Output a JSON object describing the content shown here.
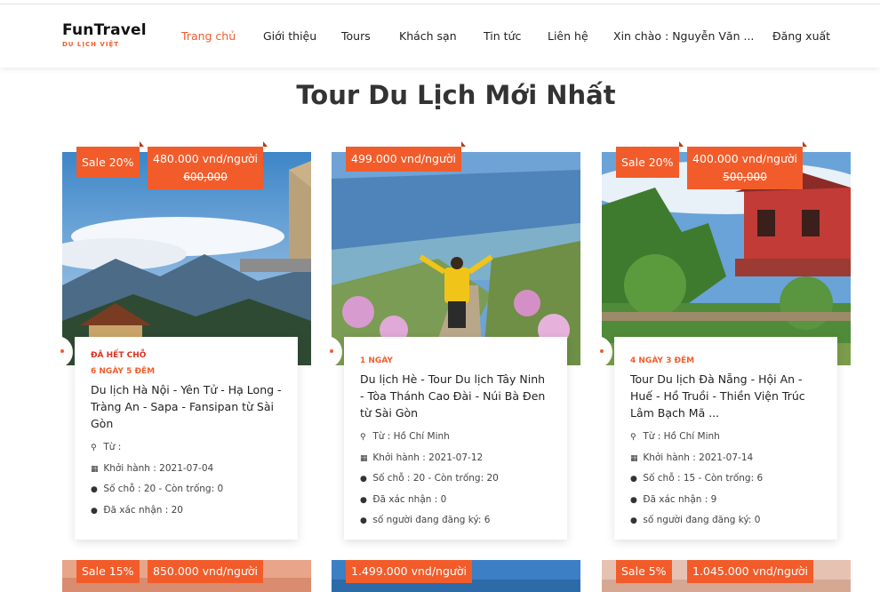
{
  "brand": {
    "name": "FunTravel",
    "tagline": "DU LỊCH VIỆT"
  },
  "nav": [
    {
      "label": "Trang chủ",
      "active": true
    },
    {
      "label": "Giới thiệu"
    },
    {
      "label": "Tours"
    },
    {
      "label": "Khách sạn"
    },
    {
      "label": "Tin tức"
    },
    {
      "label": "Liên hệ"
    },
    {
      "label": "Xin chào : Nguyễn Văn ..."
    },
    {
      "label": "Đăng xuất"
    }
  ],
  "page_title": "Tour Du Lịch Mới Nhất",
  "tours": [
    {
      "sale": "Sale 20%",
      "price": "480.000 vnd/người",
      "old_price": "600,000",
      "status": "ĐÃ HẾT CHỖ",
      "duration": "6 NGÀY 5 ĐÊM",
      "name": "Du lịch Hà Nội - Yên Tử - Hạ Long - Tràng An - Sapa - Fansipan từ Sài Gòn",
      "from": "Từ :",
      "depart": "Khởi hành : 2021-07-04",
      "seats": "Số chỗ : 20 - Còn trống: 0",
      "confirmed": "Đã xác nhận : 20",
      "registering": ""
    },
    {
      "sale": "",
      "price": "499.000 vnd/người",
      "old_price": "",
      "status": "",
      "duration": "1 NGÀY",
      "name": "Du lịch Hè - Tour Du lịch Tây Ninh - Tòa Thánh Cao Đài - Núi Bà Đen từ Sài Gòn",
      "from": "Từ : Hồ Chí Minh",
      "depart": "Khởi hành : 2021-07-12",
      "seats": "Số chỗ : 20 - Còn trống: 20",
      "confirmed": "Đã xác nhận : 0",
      "registering": "số người đang đăng ký: 6"
    },
    {
      "sale": "Sale 20%",
      "price": "400.000 vnd/người",
      "old_price": "500,000",
      "status": "",
      "duration": "4 NGÀY 3 ĐÊM",
      "name": "Tour Du lịch Đà Nẵng - Hội An - Huế - Hồ Truồi - Thiền Viện Trúc Lâm Bạch Mã ...",
      "from": "Từ : Hồ Chí Minh",
      "depart": "Khởi hành : 2021-07-14",
      "seats": "Số chỗ : 15 - Còn trống: 6",
      "confirmed": "Đã xác nhận : 9",
      "registering": "số người đang đăng ký: 0"
    }
  ],
  "tours_row2": [
    {
      "sale": "Sale 15%",
      "price": "850.000 vnd/người"
    },
    {
      "sale": "",
      "price": "1.499.000 vnd/người"
    },
    {
      "sale": "Sale 5%",
      "price": "1.045.000 vnd/người"
    }
  ],
  "colors": {
    "accent": "#f25c2a",
    "status_red": "#e0301e"
  },
  "icons": {
    "from": "map-marker-icon",
    "depart": "calendar-icon",
    "seats": "user-icon"
  }
}
